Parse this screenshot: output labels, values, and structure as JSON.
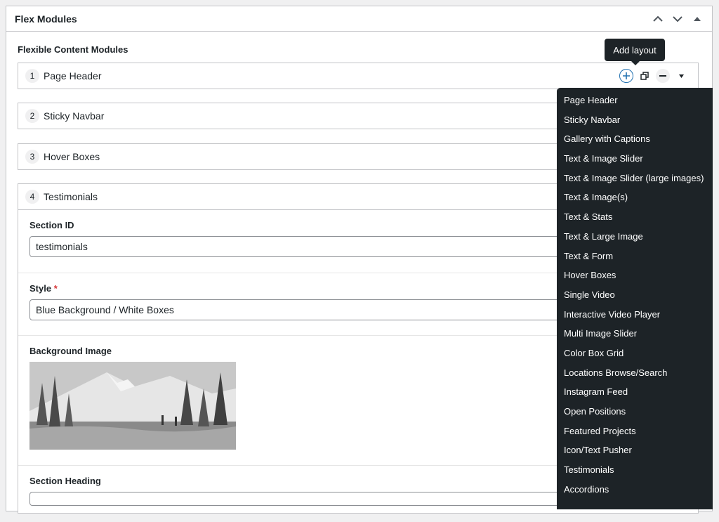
{
  "postbox": {
    "title": "Flex Modules"
  },
  "field": {
    "label": "Flexible Content Modules"
  },
  "layouts": [
    {
      "order": "1",
      "title": "Page Header"
    },
    {
      "order": "2",
      "title": "Sticky Navbar"
    },
    {
      "order": "3",
      "title": "Hover Boxes"
    },
    {
      "order": "4",
      "title": "Testimonials"
    }
  ],
  "testimonials": {
    "section_id": {
      "label": "Section ID",
      "value": "testimonials"
    },
    "style": {
      "label": "Style",
      "required": "*",
      "value": "Blue Background / White Boxes"
    },
    "background_image": {
      "label": "Background Image"
    },
    "section_heading": {
      "label": "Section Heading"
    }
  },
  "tooltip": {
    "text": "Add layout"
  },
  "popup": {
    "items": [
      "Page Header",
      "Sticky Navbar",
      "Gallery with Captions",
      "Text & Image Slider",
      "Text & Image Slider (large images)",
      "Text & Image(s)",
      "Text & Stats",
      "Text & Large Image",
      "Text & Form",
      "Hover Boxes",
      "Single Video",
      "Interactive Video Player",
      "Multi Image Slider",
      "Color Box Grid",
      "Locations Browse/Search",
      "Instagram Feed",
      "Open Positions",
      "Featured Projects",
      "Icon/Text Pusher",
      "Testimonials",
      "Accordions"
    ]
  },
  "colors": {
    "accent": "#2271b1",
    "popup_bg": "#1d2327",
    "required": "#d63638"
  }
}
